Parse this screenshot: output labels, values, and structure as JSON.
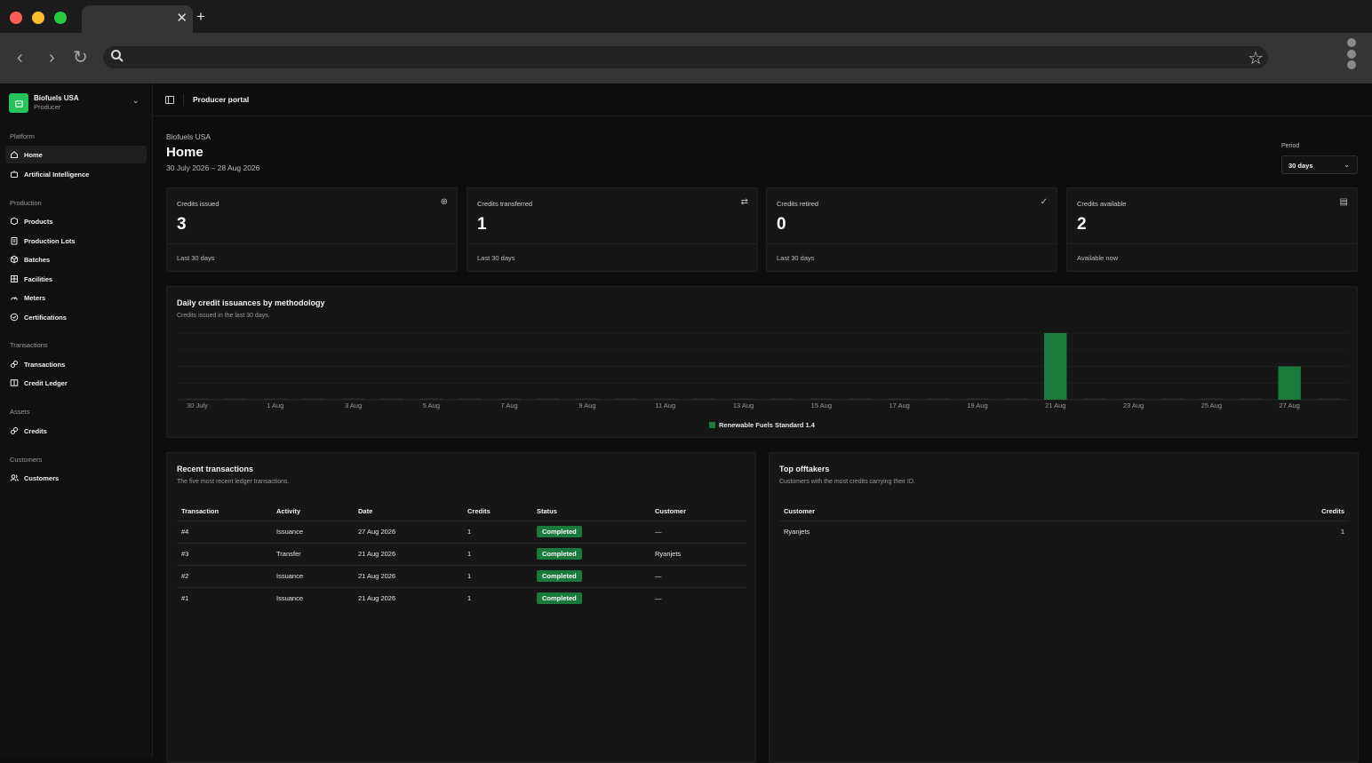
{
  "org": {
    "name": "Biofuels USA",
    "role": "Producer"
  },
  "sidebar": {
    "sections": [
      {
        "label": "Platform",
        "items": [
          {
            "label": "Home",
            "icon": "home-icon",
            "active": true
          },
          {
            "label": "Artificial Intelligence",
            "icon": "robot-icon"
          }
        ]
      },
      {
        "label": "Production",
        "items": [
          {
            "label": "Products",
            "icon": "package-icon"
          },
          {
            "label": "Production Lots",
            "icon": "clipboard-icon"
          },
          {
            "label": "Batches",
            "icon": "box-icon"
          },
          {
            "label": "Facilities",
            "icon": "building-icon"
          },
          {
            "label": "Meters",
            "icon": "gauge-icon"
          },
          {
            "label": "Certifications",
            "icon": "check-circle-icon"
          }
        ]
      },
      {
        "label": "Transactions",
        "items": [
          {
            "label": "Transactions",
            "icon": "link-icon"
          },
          {
            "label": "Credit Ledger",
            "icon": "book-icon"
          }
        ]
      },
      {
        "label": "Assets",
        "items": [
          {
            "label": "Credits",
            "icon": "link-icon"
          }
        ]
      },
      {
        "label": "Customers",
        "items": [
          {
            "label": "Customers",
            "icon": "users-icon"
          }
        ]
      }
    ]
  },
  "topbar": {
    "title": "Producer portal"
  },
  "header": {
    "crumb": "Biofuels USA",
    "title": "Home",
    "date_range": "30 July 2026 – 28 Aug 2026",
    "period_label": "Period",
    "period_value": "30 days"
  },
  "stats": [
    {
      "label": "Credits issued",
      "value": "3",
      "foot": "Last 30 days",
      "icon": "plus-circle-icon",
      "glyph": "⊕"
    },
    {
      "label": "Credits transferred",
      "value": "1",
      "foot": "Last 30 days",
      "icon": "swap-icon",
      "glyph": "⇄"
    },
    {
      "label": "Credits retired",
      "value": "0",
      "foot": "Last 30 days",
      "icon": "check-circle-icon",
      "glyph": "✓"
    },
    {
      "label": "Credits available",
      "value": "2",
      "foot": "Available now",
      "icon": "archive-icon",
      "glyph": "▤"
    }
  ],
  "chart_card": {
    "title": "Daily credit issuances by methodology",
    "subtitle": "Credits issued in the last 30 days."
  },
  "chart_data": {
    "type": "bar",
    "title": "Daily credit issuances by methodology",
    "categories": [
      "30 July",
      "31 July",
      "1 Aug",
      "2 Aug",
      "3 Aug",
      "4 Aug",
      "5 Aug",
      "6 Aug",
      "7 Aug",
      "8 Aug",
      "9 Aug",
      "10 Aug",
      "11 Aug",
      "12 Aug",
      "13 Aug",
      "14 Aug",
      "15 Aug",
      "16 Aug",
      "17 Aug",
      "18 Aug",
      "19 Aug",
      "20 Aug",
      "21 Aug",
      "22 Aug",
      "23 Aug",
      "24 Aug",
      "25 Aug",
      "26 Aug",
      "27 Aug",
      "28 Aug"
    ],
    "tick_labels": [
      "30 July",
      "1 Aug",
      "3 Aug",
      "5 Aug",
      "7 Aug",
      "9 Aug",
      "11 Aug",
      "13 Aug",
      "15 Aug",
      "17 Aug",
      "19 Aug",
      "21 Aug",
      "23 Aug",
      "25 Aug",
      "27 Aug"
    ],
    "series": [
      {
        "name": "Renewable Fuels Standard 1.4",
        "color": "#1a7a3c",
        "values": [
          0,
          0,
          0,
          0,
          0,
          0,
          0,
          0,
          0,
          0,
          0,
          0,
          0,
          0,
          0,
          0,
          0,
          0,
          0,
          0,
          0,
          0,
          2,
          0,
          0,
          0,
          0,
          0,
          1,
          0
        ]
      }
    ],
    "ylim": [
      0,
      2
    ],
    "grid": true,
    "legend": "bottom"
  },
  "recent": {
    "title": "Recent transactions",
    "subtitle": "The five most recent ledger transactions.",
    "columns": [
      "Transaction",
      "Activity",
      "Date",
      "Credits",
      "Status",
      "Customer"
    ],
    "rows": [
      {
        "id": "#4",
        "activity": "Issuance",
        "date": "27 Aug 2026",
        "credits": "1",
        "status": "Completed",
        "customer": "—",
        "customer_link": false
      },
      {
        "id": "#3",
        "activity": "Transfer",
        "date": "21 Aug 2026",
        "credits": "1",
        "status": "Completed",
        "customer": "Ryanjets",
        "customer_link": true
      },
      {
        "id": "#2",
        "activity": "Issuance",
        "date": "21 Aug 2026",
        "credits": "1",
        "status": "Completed",
        "customer": "—",
        "customer_link": false
      },
      {
        "id": "#1",
        "activity": "Issuance",
        "date": "21 Aug 2026",
        "credits": "1",
        "status": "Completed",
        "customer": "—",
        "customer_link": false
      }
    ]
  },
  "offtakers": {
    "title": "Top offtakers",
    "subtitle": "Customers with the most credits carrying their ID.",
    "columns": [
      "Customer",
      "Credits"
    ],
    "rows": [
      {
        "customer": "Ryanjets",
        "credits": "1"
      }
    ]
  },
  "colors": {
    "accent": "#24c45a",
    "bar": "#1a7a3c",
    "link": "#1f7a3e"
  }
}
